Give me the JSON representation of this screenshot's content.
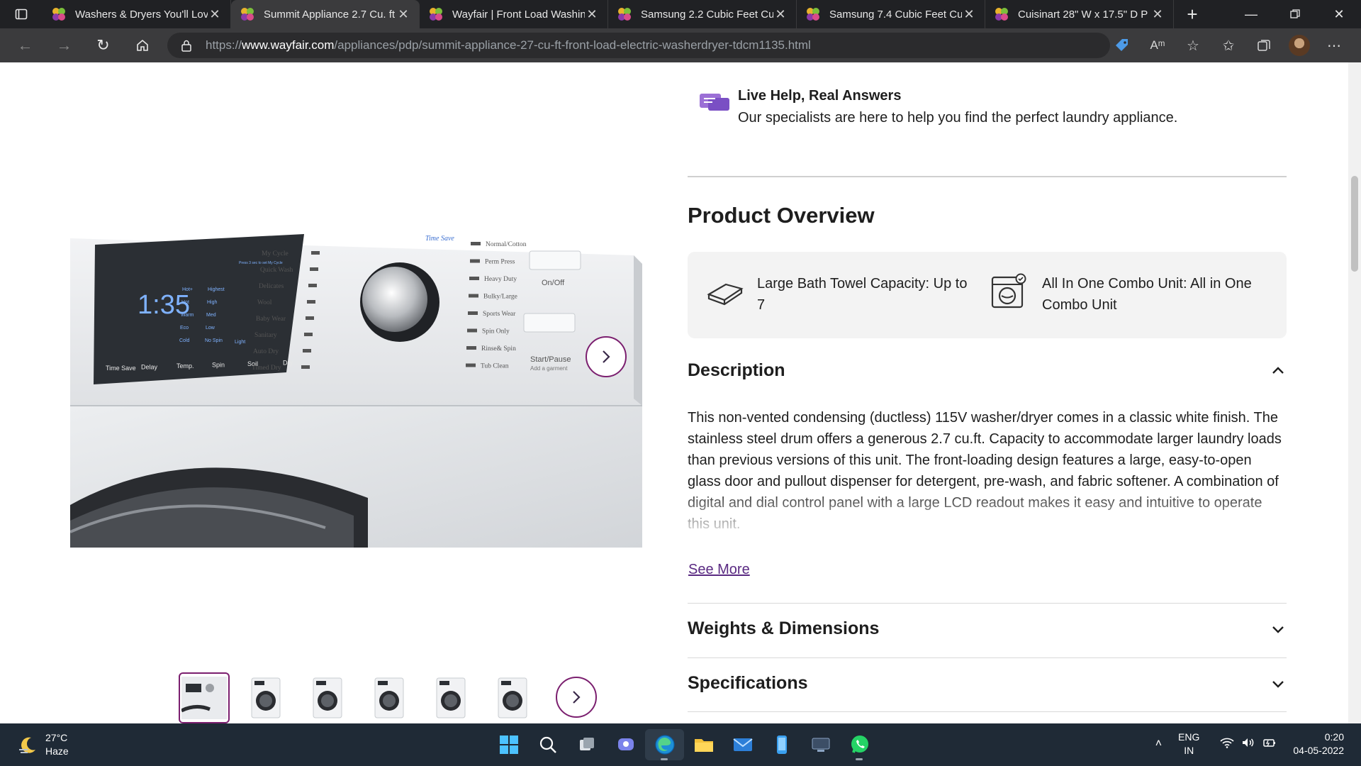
{
  "browser": {
    "tabs": [
      {
        "title": "Washers & Dryers You'll Lov",
        "active": false
      },
      {
        "title": "Summit Appliance 2.7 Cu. ft",
        "active": true
      },
      {
        "title": "Wayfair | Front Load Washin",
        "active": false
      },
      {
        "title": "Samsung 2.2 Cubic Feet Cu",
        "active": false
      },
      {
        "title": "Samsung 7.4 Cubic Feet Cu",
        "active": false
      },
      {
        "title": "Cuisinart 28\" W x 17.5\" D P",
        "active": false
      }
    ],
    "new_tab_label": "+",
    "url_prefix": "https://",
    "url_domain": "www.wayfair.com",
    "url_path": "/appliances/pdp/summit-appliance-27-cu-ft-front-load-electric-washerdryer-tdcm1135.html"
  },
  "live_help": {
    "title": "Live Help, Real Answers",
    "subtitle": "Our specialists are here to help you find the perfect laundry appliance."
  },
  "overview": {
    "title": "Product Overview",
    "items": [
      {
        "text": "Large Bath Towel Capacity: Up to 7",
        "icon": "towel-icon"
      },
      {
        "text": "All In One Combo Unit: All in One Combo Unit",
        "icon": "washer-icon"
      }
    ]
  },
  "description": {
    "heading": "Description",
    "text": "This non-vented condensing (ductless) 115V washer/dryer comes in a classic white finish. The stainless steel drum offers a generous 2.7 cu.ft. Capacity to accommodate larger laundry loads than previous versions of this unit. The front-loading design features a large, easy-to-open glass door and pullout dispenser for detergent, pre-wash, and fabric softener. A combination of digital and dial control panel with a large LCD readout makes it easy and intuitive to operate this unit.",
    "see_more": "See More"
  },
  "accordions": [
    {
      "heading": "Weights & Dimensions"
    },
    {
      "heading": "Specifications"
    }
  ],
  "product_image": {
    "display_time": "1:35",
    "cycles_left": [
      "My Cycle",
      "Quick Wash",
      "Delicates",
      "Wool",
      "Baby Wear",
      "Sanitary",
      "Auto Dry",
      "Timed Dry"
    ],
    "cycles_right": [
      "Normal/Cotton",
      "Perm Press",
      "Heavy Duty",
      "Bulky/Large",
      "Sports Wear",
      "Spin Only",
      "Rinse& Spin",
      "Tub Clean"
    ],
    "time_save": "Time Save",
    "on_off": "On/Off",
    "start_pause": "Start/Pause",
    "add_garment": "Add a garment",
    "panel_buttons": [
      "Time Save",
      "Delay",
      "Temp.",
      "Spin",
      "Soil",
      "Dry"
    ],
    "temps": [
      "Hot+",
      "Hot",
      "Warm",
      "Eco",
      "Cold"
    ],
    "spins": [
      "Highest",
      "High",
      "Med",
      "Low",
      "No Spin"
    ],
    "light": "Light",
    "press_hint": "Press 3 sec to set My Cycle"
  },
  "thumbnails_count": 6,
  "taskbar": {
    "temperature": "27°C",
    "condition": "Haze",
    "lang_top": "ENG",
    "lang_bottom": "IN",
    "time": "0:20",
    "date": "04-05-2022"
  },
  "colors": {
    "brand_purple": "#7b1f6f",
    "link_purple": "#5a2a82",
    "chrome_dark": "#202124",
    "taskbar": "#1f2a36"
  }
}
